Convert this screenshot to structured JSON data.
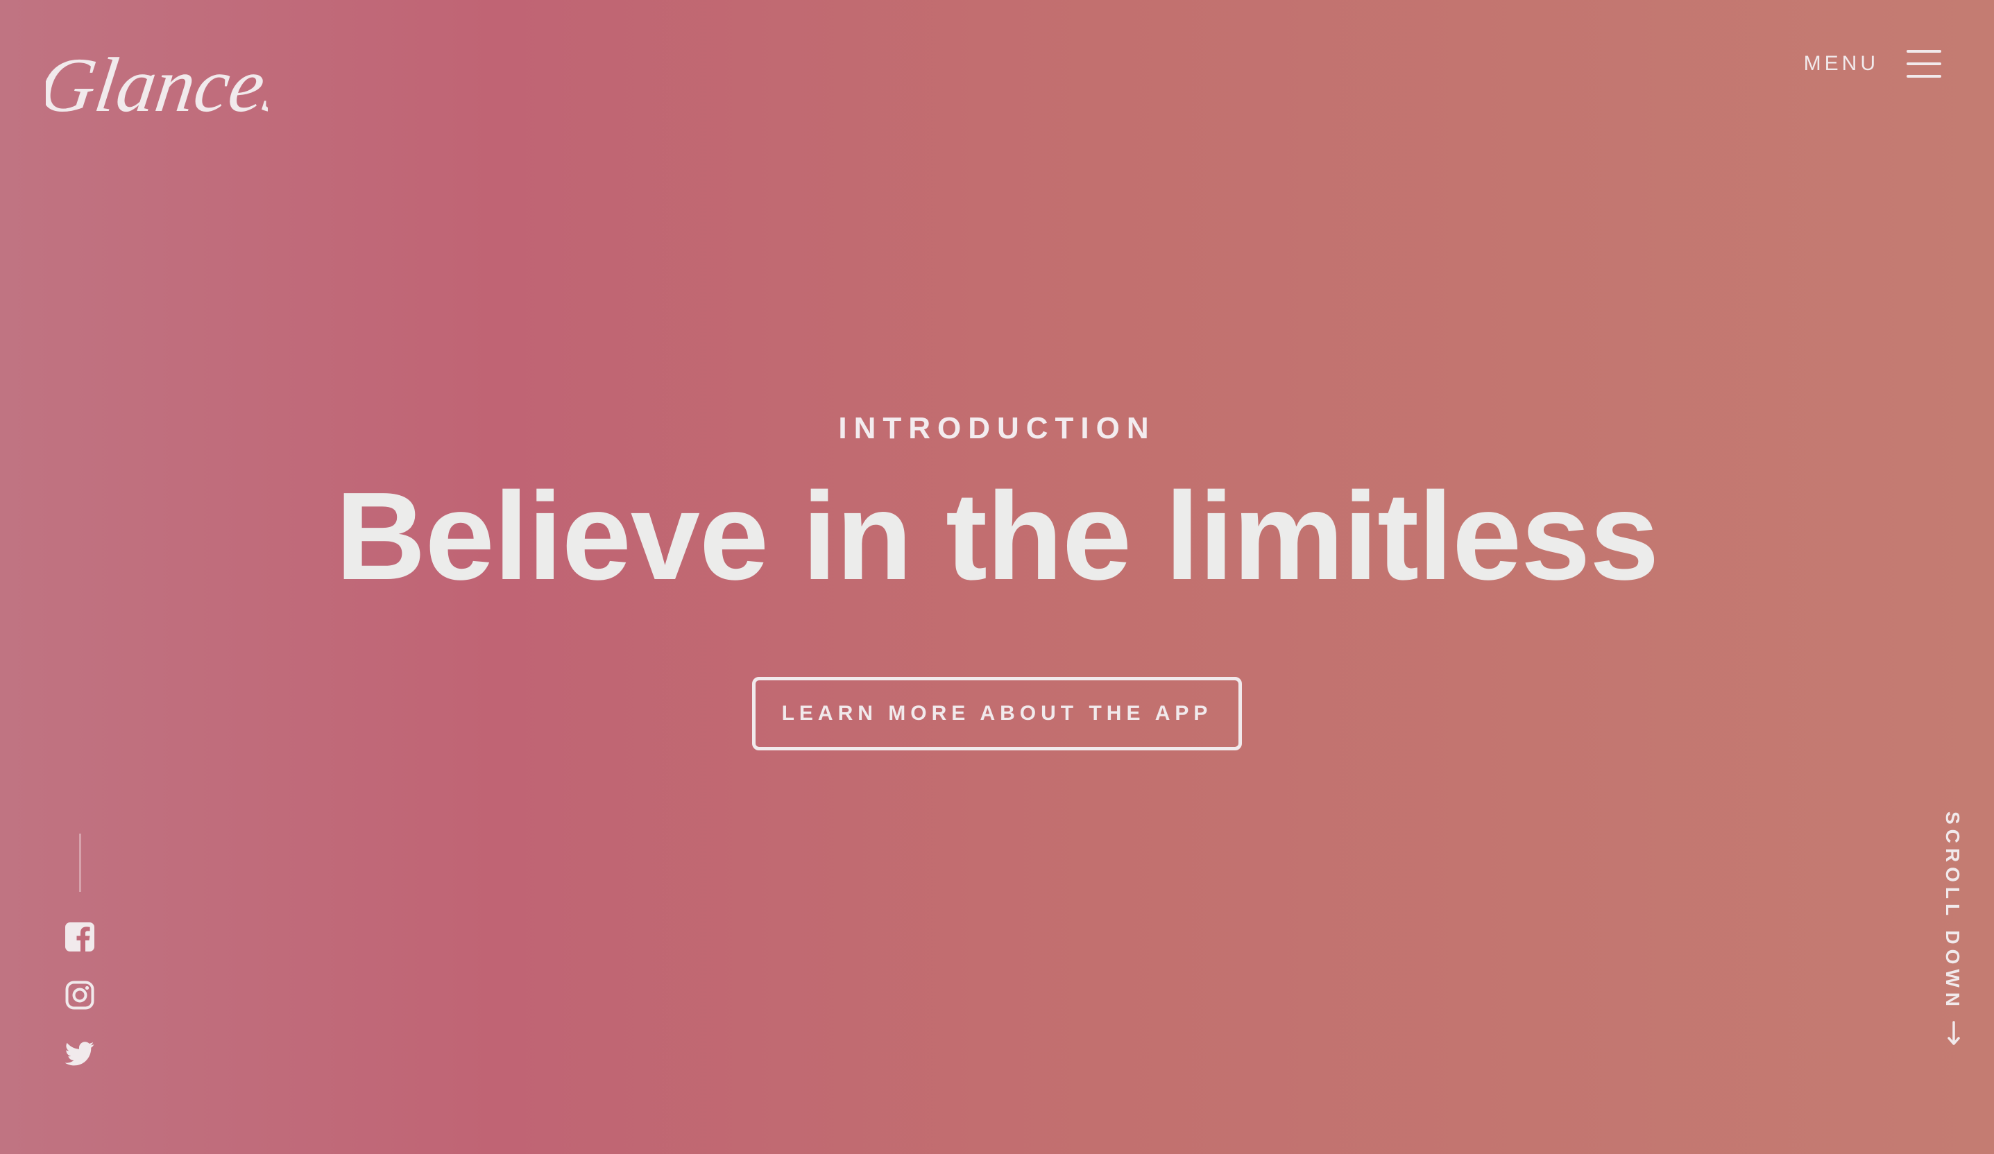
{
  "brand": {
    "logo_text": "Glances"
  },
  "nav": {
    "menu_label": "MENU",
    "menu_icon": "hamburger-icon"
  },
  "hero": {
    "eyebrow": "INTRODUCTION",
    "headline": "Believe in the limitless",
    "cta_label": "LEARN MORE ABOUT THE APP"
  },
  "social": [
    {
      "name": "facebook",
      "icon": "facebook-icon"
    },
    {
      "name": "instagram",
      "icon": "instagram-icon"
    },
    {
      "name": "twitter",
      "icon": "twitter-icon"
    }
  ],
  "scroll": {
    "label": "SCROLL DOWN",
    "icon": "arrow-down-icon"
  },
  "colors": {
    "background_start": "#c07482",
    "background_mid": "#c06474",
    "background_end": "#c47c72",
    "foreground": "#efe9ec"
  }
}
